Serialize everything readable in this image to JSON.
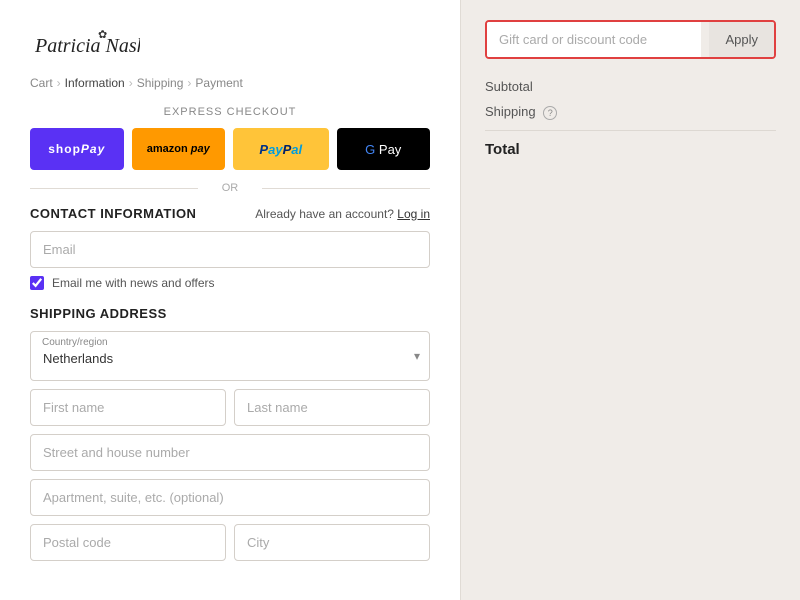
{
  "logo": {
    "text": "Patricia Nash",
    "flower_symbol": "✿"
  },
  "breadcrumb": {
    "items": [
      "Cart",
      "Information",
      "Shipping",
      "Payment"
    ],
    "active": "Information"
  },
  "express_checkout": {
    "label": "EXPRESS CHECKOUT",
    "buttons": [
      {
        "id": "shoppay",
        "label": "shop Pay"
      },
      {
        "id": "amazonpay",
        "label": "amazon pay"
      },
      {
        "id": "paypal",
        "label": "PayPal"
      },
      {
        "id": "gpay",
        "label": "G Pay"
      }
    ]
  },
  "or_label": "OR",
  "contact": {
    "title": "CONTACT INFORMATION",
    "already_account": "Already have an account?",
    "login_label": "Log in",
    "email_placeholder": "Email",
    "newsletter_label": "Email me with news and offers"
  },
  "shipping": {
    "title": "SHIPPING ADDRESS",
    "country_label": "Country/region",
    "country_value": "Netherlands",
    "first_name_placeholder": "First name",
    "last_name_placeholder": "Last name",
    "street_placeholder": "Street and house number",
    "apt_placeholder": "Apartment, suite, etc. (optional)",
    "postal_placeholder": "Postal code",
    "city_placeholder": "City"
  },
  "order_summary": {
    "discount_placeholder": "Gift card or discount code",
    "apply_label": "Apply",
    "subtotal_label": "Subtotal",
    "shipping_label": "Shipping",
    "total_label": "Total"
  }
}
